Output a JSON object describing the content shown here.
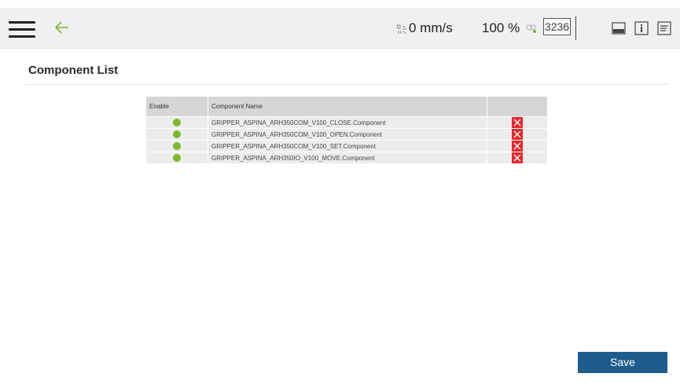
{
  "header": {
    "speed": "0 mm/s",
    "speed_icon": "speed-icon",
    "override": "100 %",
    "link_icon": "link-icon",
    "counter": "3236",
    "icons": [
      "menu-icon",
      "back-arrow-icon",
      "monitor-icon",
      "info-icon",
      "log-icon"
    ]
  },
  "page": {
    "title": "Component List"
  },
  "table": {
    "headers": {
      "enable": "Enable",
      "name": "Component Name",
      "action": ""
    },
    "rows": [
      {
        "enabled": true,
        "name": "GRIPPER_ASPINA_ARH350COM_V100_CLOSE.Component"
      },
      {
        "enabled": true,
        "name": "GRIPPER_ASPINA_ARH350COM_V100_OPEN.Component"
      },
      {
        "enabled": true,
        "name": "GRIPPER_ASPINA_ARH350COM_V100_SET.Component"
      },
      {
        "enabled": true,
        "name": "GRIPPER_ASPINA_ARH350IO_V100_MOVE.Component"
      }
    ]
  },
  "footer": {
    "save_label": "Save"
  },
  "colors": {
    "enabled_dot": "#7ab929",
    "delete_bg": "#e8262b",
    "save_button": "#1e5c8e",
    "back_arrow": "#7ab929"
  }
}
